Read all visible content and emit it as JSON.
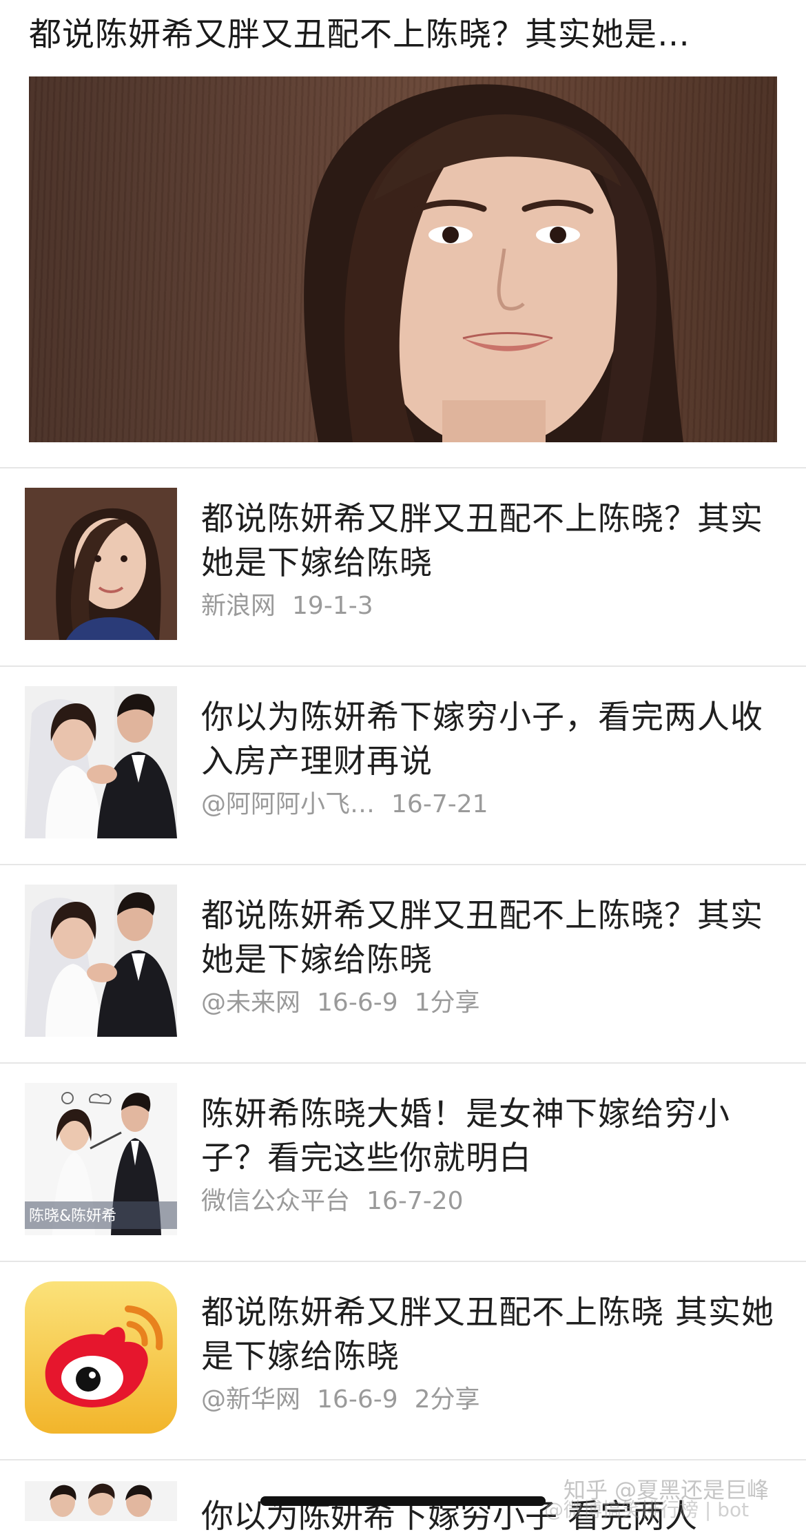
{
  "top": {
    "title": "都说陈妍希又胖又丑配不上陈晓？其实她是…"
  },
  "items": [
    {
      "title": "都说陈妍希又胖又丑配不上陈晓？其实她是下嫁给陈晓",
      "source": "新浪网",
      "date": "19-1-3",
      "extra": "",
      "thumb": "portrait-photo"
    },
    {
      "title": "你以为陈妍希下嫁穷小子，看完两人收入房产理财再说",
      "source": "@阿阿阿小飞…",
      "date": "16-7-21",
      "extra": "",
      "thumb": "wedding-photo"
    },
    {
      "title": "都说陈妍希又胖又丑配不上陈晓？其实她是下嫁给陈晓",
      "source": "@未来网",
      "date": "16-6-9",
      "extra": "1分享",
      "thumb": "wedding-photo"
    },
    {
      "title": "陈妍希陈晓大婚！是女神下嫁给穷小子？看完这些你就明白",
      "source": "微信公众平台",
      "date": "16-7-20",
      "extra": "",
      "thumb": "couple-poster",
      "thumb_caption": "陈晓&陈妍希"
    },
    {
      "title": "都说陈妍希又胖又丑配不上陈晓 其实她是下嫁给陈晓",
      "source": "@新华网",
      "date": "16-6-9",
      "extra": "2分享",
      "thumb": "weibo-icon"
    }
  ],
  "partial": {
    "title": "你以为陈妍希下嫁穷小子 看完两人"
  },
  "watermark": {
    "line1": "知乎 @夏黑还是巨峰",
    "line2": "@微博搞笑排行榜 | bot"
  },
  "colors": {
    "text": "#1f1f1f",
    "meta": "#9a9a9a",
    "divider": "#e6e6e6",
    "weibo_bg": "#f6c544",
    "weibo_red": "#e6162d"
  }
}
